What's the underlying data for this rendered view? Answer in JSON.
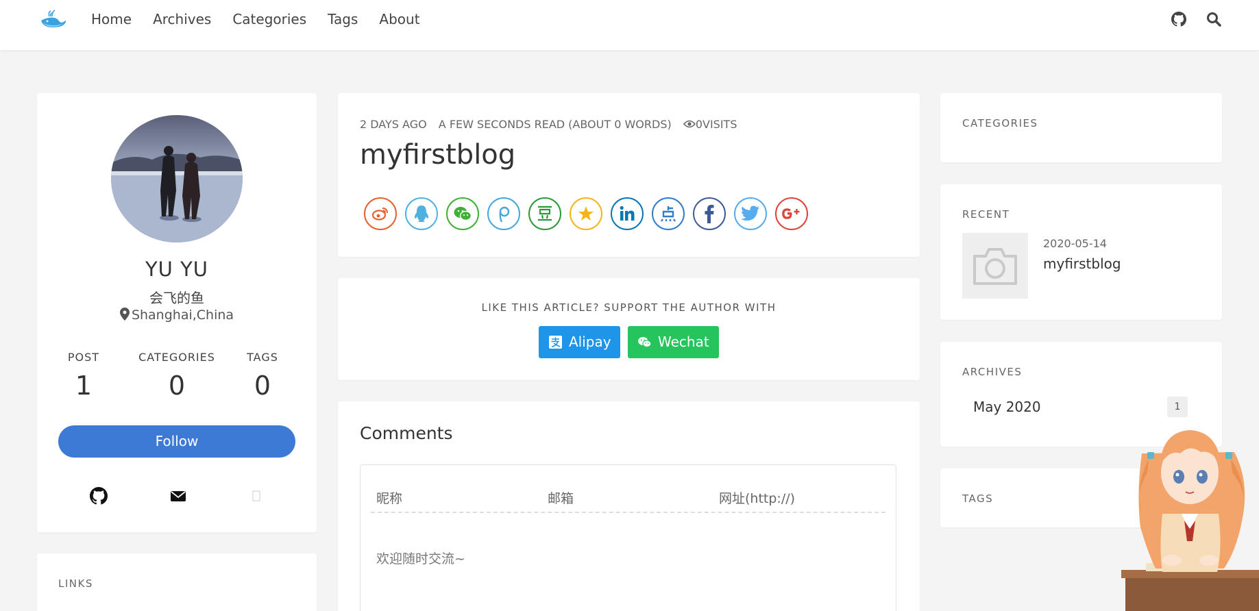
{
  "nav": {
    "items": [
      "Home",
      "Archives",
      "Categories",
      "Tags",
      "About"
    ],
    "right_icons": [
      "github-icon",
      "search-icon"
    ]
  },
  "profile": {
    "name": "YU YU",
    "subtitle": "会飞的鱼",
    "location": "Shanghai,China",
    "stats": [
      {
        "label": "POST",
        "value": "1"
      },
      {
        "label": "CATEGORIES",
        "value": "0"
      },
      {
        "label": "TAGS",
        "value": "0"
      }
    ],
    "follow_label": "Follow",
    "social_icons": [
      "github-icon",
      "mail-icon",
      "missing-icon"
    ]
  },
  "links": {
    "label": "LINKS"
  },
  "post": {
    "meta_date": "2 DAYS AGO",
    "meta_read": "A FEW SECONDS READ (ABOUT 0 WORDS)",
    "meta_visits": "0VISITS",
    "title": "myfirstblog",
    "share_buttons": [
      {
        "name": "weibo",
        "color": "#e6612c"
      },
      {
        "name": "qq",
        "color": "#4fb1e0"
      },
      {
        "name": "wechat",
        "color": "#3eb135"
      },
      {
        "name": "tencent-weibo",
        "color": "#47a7d8"
      },
      {
        "name": "douban",
        "color": "#2a9a39"
      },
      {
        "name": "qzone",
        "color": "#f7b41a"
      },
      {
        "name": "linkedin",
        "color": "#0777b5"
      },
      {
        "name": "diandian",
        "color": "#307dca"
      },
      {
        "name": "facebook",
        "color": "#3d5a98"
      },
      {
        "name": "twitter",
        "color": "#55acee"
      },
      {
        "name": "google-plus",
        "color": "#db4437"
      }
    ]
  },
  "support": {
    "label": "LIKE THIS ARTICLE? SUPPORT THE AUTHOR WITH",
    "alipay_label": "Alipay",
    "wechat_label": "Wechat",
    "alipay_color": "#1e95e9",
    "wechat_color": "#26c45c"
  },
  "comments": {
    "title": "Comments",
    "nickname_placeholder": "昵称",
    "email_placeholder": "邮箱",
    "url_placeholder": "网址(http://)",
    "text_placeholder": "欢迎随时交流~"
  },
  "sidebar": {
    "categories_label": "CATEGORIES",
    "recent_label": "RECENT",
    "recent_date": "2020-05-14",
    "recent_title": "myfirstblog",
    "archives_label": "ARCHIVES",
    "archive_month": "May 2020",
    "archive_count": "1",
    "tags_label": "TAGS"
  },
  "colors": {
    "accent": "#3d7ad6",
    "background": "#f4f4f4"
  }
}
